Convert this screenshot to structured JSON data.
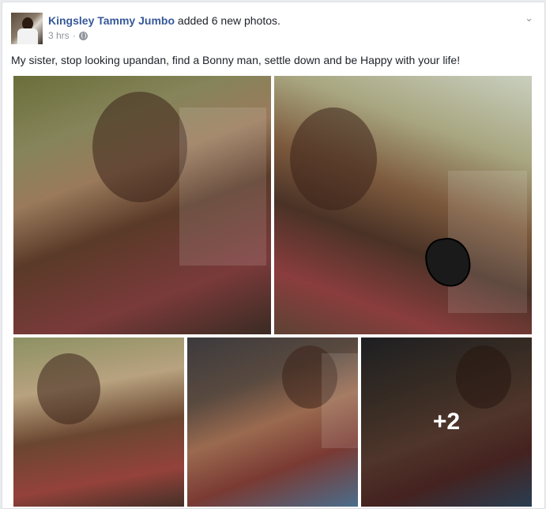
{
  "post": {
    "author": "Kingsley Tammy Jumbo",
    "action": " added 6 new photos.",
    "time": "3 hrs",
    "separator": "·",
    "privacy_icon": "globe-icon",
    "menu_icon": "chevron-down-icon",
    "menu_glyph": "⌄",
    "text": "My sister, stop looking upandan, find a Bonny man, settle down and be Happy with your life!"
  },
  "photos": {
    "count_shown": 5,
    "more_count_label": "+2"
  }
}
